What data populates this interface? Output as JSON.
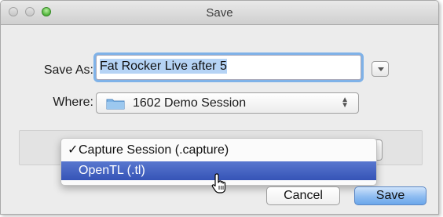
{
  "window": {
    "title": "Save"
  },
  "form": {
    "save_as_label": "Save As:",
    "save_as_value": "Fat Rocker Live after 5",
    "where_label": "Where:",
    "where_value": "1602 Demo Session"
  },
  "format_menu": {
    "items": [
      {
        "label": "Capture Session (.capture)",
        "checked": true,
        "check_mark": "✓"
      },
      {
        "label": "OpenTL (.tl)",
        "highlighted": true
      }
    ]
  },
  "buttons": {
    "cancel": "Cancel",
    "save": "Save"
  },
  "icons": [
    "close-icon",
    "minimize-icon",
    "zoom-icon",
    "chevron-down-icon",
    "folder-icon",
    "up-down-arrows-icon",
    "hand-pointer-icon"
  ],
  "colors": {
    "highlight": "#3f5fc4",
    "focus_ring": "#7fb2e8",
    "default_button": "#8ebcf1"
  }
}
